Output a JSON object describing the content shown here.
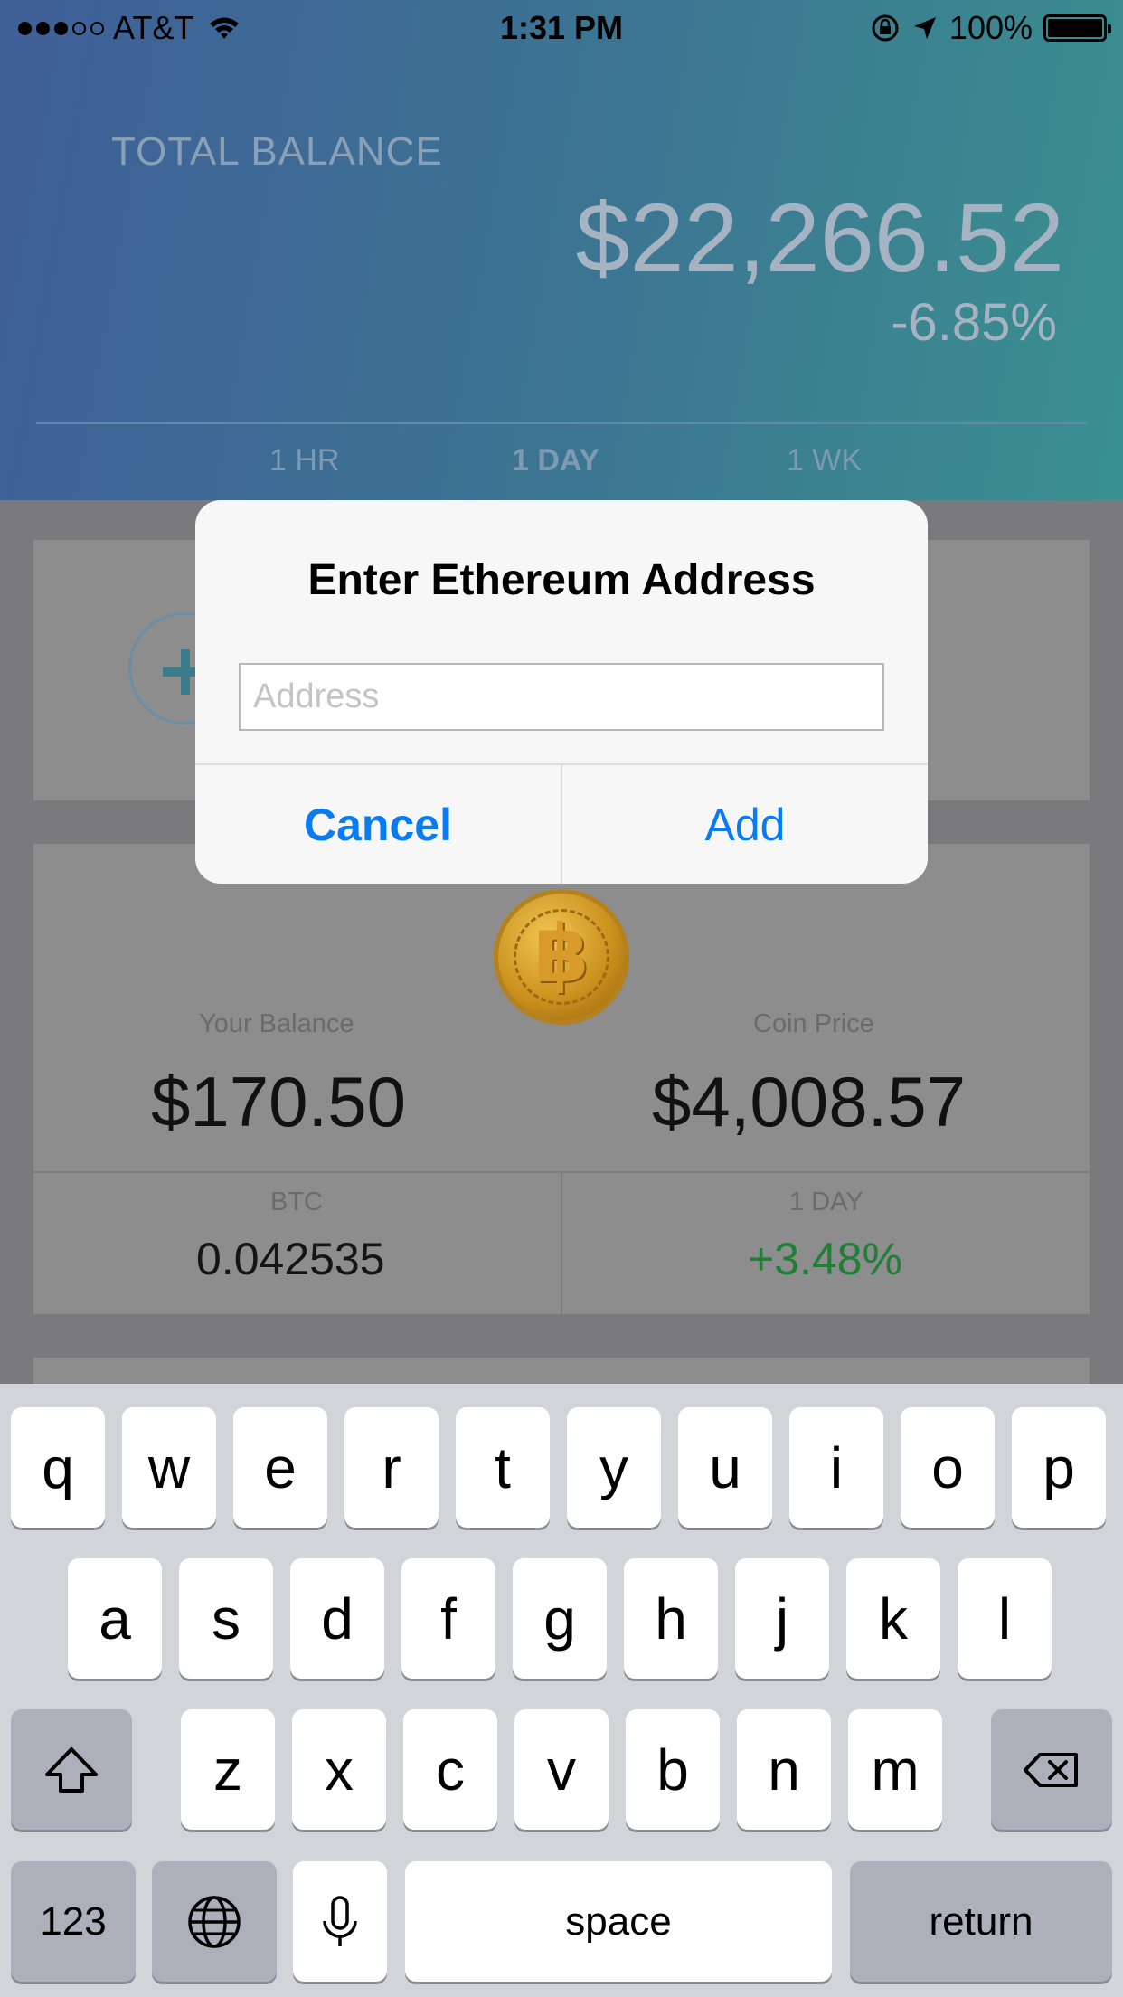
{
  "status_bar": {
    "carrier": "AT&T",
    "time": "1:31 PM",
    "battery": "100%"
  },
  "header": {
    "total_balance_label": "TOTAL BALANCE",
    "total_balance_value": "$22,266.52",
    "change": "-6.85%",
    "tabs": [
      {
        "label": "1 HR"
      },
      {
        "label": "1 DAY",
        "selected": true
      },
      {
        "label": "1 WK"
      }
    ]
  },
  "coin_card": {
    "icon": "bitcoin-coin-icon",
    "your_balance_label": "Your Balance",
    "your_balance_value": "$170.50",
    "coin_price_label": "Coin Price",
    "coin_price_value": "$4,008.57",
    "symbol_label": "BTC",
    "symbol_amount": "0.042535",
    "period_label": "1 DAY",
    "period_change": "+3.48%"
  },
  "alert": {
    "title": "Enter Ethereum Address",
    "input_placeholder": "Address",
    "input_value": "",
    "cancel_label": "Cancel",
    "add_label": "Add"
  },
  "keyboard": {
    "row1": [
      "q",
      "w",
      "e",
      "r",
      "t",
      "y",
      "u",
      "i",
      "o",
      "p"
    ],
    "row2": [
      "a",
      "s",
      "d",
      "f",
      "g",
      "h",
      "j",
      "k",
      "l"
    ],
    "row3": [
      "z",
      "x",
      "c",
      "v",
      "b",
      "n",
      "m"
    ],
    "numbers_label": "123",
    "space_label": "space",
    "return_label": "return"
  },
  "colors": {
    "accent": "#0a7bf0",
    "positive": "#1f7f36",
    "header_start": "#3f5f98",
    "header_end": "#3a9090"
  }
}
